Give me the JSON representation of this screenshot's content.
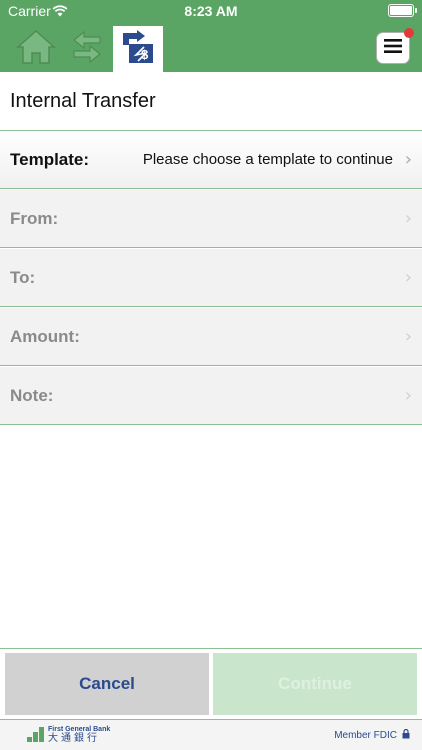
{
  "status_bar": {
    "carrier": "Carrier",
    "time": "8:23 AM"
  },
  "nav": {
    "home_icon": "home-icon",
    "swap_icon": "swap-arrows-icon",
    "transfer_icon": "dollar-transfer-icon",
    "menu_icon": "hamburger-menu-icon"
  },
  "page": {
    "title": "Internal Transfer"
  },
  "form": {
    "template_label": "Template:",
    "template_value": "Please choose a template to continue",
    "from_label": "From:",
    "to_label": "To:",
    "amount_label": "Amount:",
    "note_label": "Note:"
  },
  "actions": {
    "cancel_label": "Cancel",
    "continue_label": "Continue"
  },
  "footer": {
    "bank_name_en": "First General Bank",
    "bank_name_zh": "大通銀行",
    "member": "Member FDIC"
  },
  "colors": {
    "header_green": "#5aa564",
    "brand_blue": "#2b4b8e",
    "notification_red": "#e23a3a"
  }
}
